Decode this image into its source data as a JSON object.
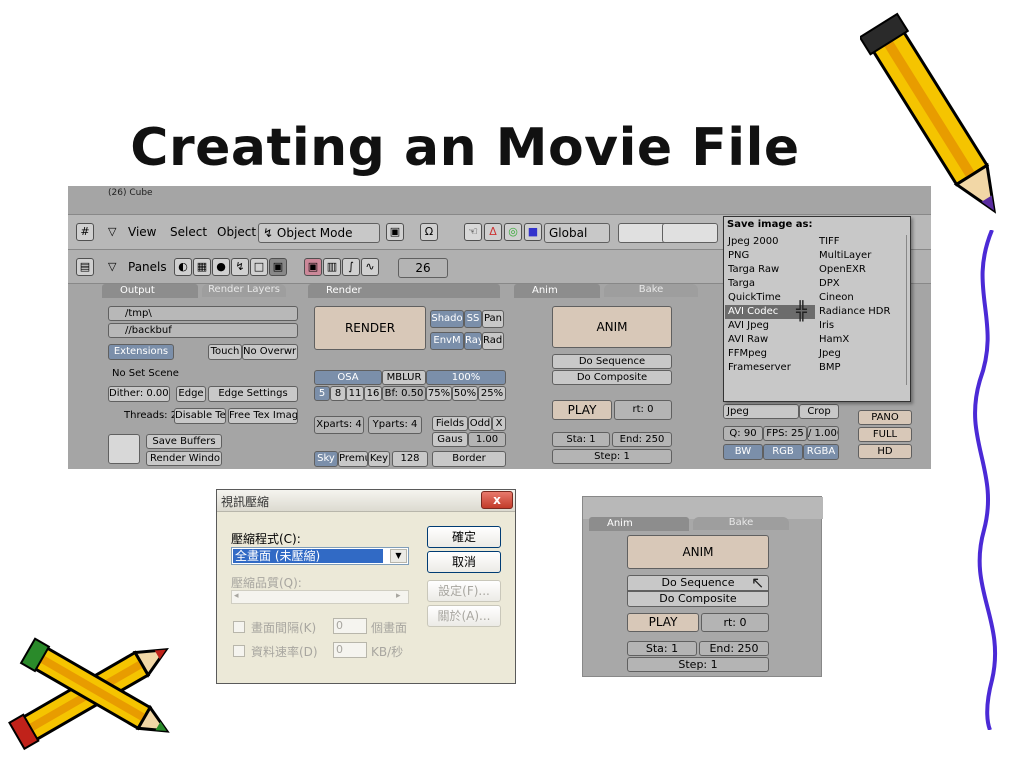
{
  "slide": {
    "title": "Creating an Movie File"
  },
  "blender": {
    "top_caption": "(26) Cube",
    "header": {
      "menus": [
        "View",
        "Select",
        "Object"
      ],
      "mode": "Object Mode",
      "orientation": "Global"
    },
    "panels_bar": {
      "label": "Panels",
      "frame": "26"
    },
    "output_panel": {
      "tab_active": "Output",
      "tab_inactive": "Render Layers",
      "path1": "/tmp\\",
      "path2": "//backbuf",
      "extensions": "Extensions",
      "touch": "Touch",
      "no_overwrite": "No Overwrit",
      "no_set_scene": "No Set Scene",
      "dither": "Dither: 0.000",
      "edge": "Edge",
      "edge_settings": "Edge Settings",
      "threads": "Threads: 2",
      "disable_te": "Disable Te",
      "free_tex": "Free Tex Imag",
      "save_buffers": "Save Buffers",
      "render_window": "Render Windo"
    },
    "render_panel": {
      "tab": "Render",
      "render_button": "RENDER",
      "shado": "Shado",
      "ss": "SS",
      "pan": "Pan",
      "envm": "EnvM",
      "ray": "Ray",
      "radi": "Radi",
      "osa": "OSA",
      "mblur": "MBLUR",
      "percent": "100%",
      "osa_values": [
        "5",
        "8",
        "11",
        "16"
      ],
      "bf": "Bf: 0.50",
      "percent_values": [
        "75%",
        "50%",
        "25%"
      ],
      "xparts": "Xparts: 4",
      "yparts": "Yparts: 4",
      "fields": "Fields",
      "odd": "Odd",
      "x": "X",
      "gaus": "Gaus",
      "gaus_val": "1.00",
      "sky": "Sky",
      "premu": "Premu",
      "key": "Key",
      "depth": "128",
      "border": "Border"
    },
    "anim_panel": {
      "tab": "Anim",
      "tab2": "Bake",
      "anim": "ANIM",
      "do_sequence": "Do Sequence",
      "do_composite": "Do Composite",
      "play": "PLAY",
      "rt": "rt: 0",
      "sta": "Sta: 1",
      "end": "End: 250",
      "step": "Step: 1"
    },
    "format_panel": {
      "format": "Jpeg",
      "crop": "Crop",
      "q": "Q: 90",
      "fps": "FPS: 25",
      "fps_div": "/ 1.000",
      "bw": "BW",
      "rgb": "RGB",
      "rgba": "RGBA",
      "pano": "PANO",
      "full": "FULL",
      "hd": "HD"
    },
    "save_popup": {
      "title": "Save image as:",
      "left_items": [
        "Jpeg 2000",
        "PNG",
        "Targa Raw",
        "Targa",
        "QuickTime",
        "AVI Codec",
        "AVI Jpeg",
        "AVI Raw",
        "FFMpeg",
        "Frameserver"
      ],
      "right_items": [
        "TIFF",
        "MultiLayer",
        "OpenEXR",
        "DPX",
        "Cineon",
        "Radiance HDR",
        "Iris",
        "HamX",
        "Jpeg",
        "BMP"
      ],
      "selected": "AVI Codec"
    }
  },
  "dialog": {
    "title": "視訊壓縮",
    "close": "x",
    "codec_label": "壓縮程式(C):",
    "codec_value": "全畫面 (未壓縮)",
    "quality_label": "壓縮品質(Q):",
    "keyframe_label": "畫面間隔(K)",
    "keyframe_value": "0",
    "keyframe_unit": "個畫面",
    "datarate_label": "資料速率(D)",
    "datarate_value": "0",
    "datarate_unit": "KB/秒",
    "ok": "確定",
    "cancel": "取消",
    "configure": "設定(F)...",
    "about": "關於(A)..."
  },
  "anim_zoom": {
    "tab": "Anim",
    "tab2": "Bake",
    "anim": "ANIM",
    "do_sequence": "Do Sequence",
    "do_composite": "Do Composite",
    "play": "PLAY",
    "rt": "rt: 0",
    "sta": "Sta: 1",
    "end": "End: 250",
    "step": "Step: 1"
  }
}
